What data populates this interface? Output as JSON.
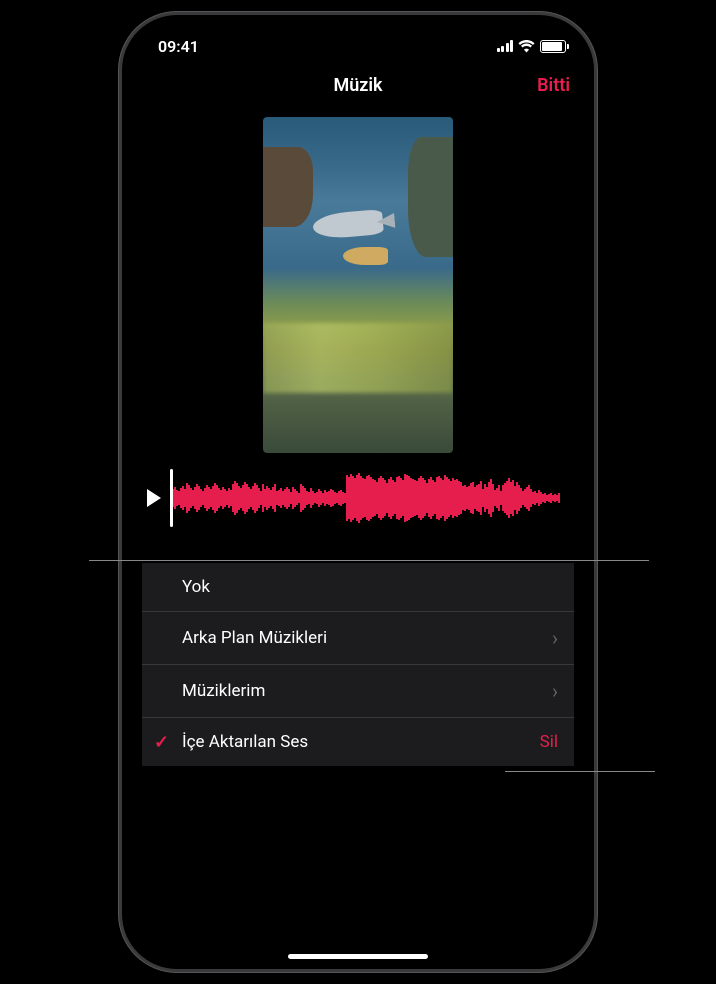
{
  "status": {
    "time": "09:41"
  },
  "nav": {
    "title": "Müzik",
    "done": "Bitti"
  },
  "options": {
    "none": "Yok",
    "soundtracks": "Arka Plan Müzikleri",
    "my_music": "Müziklerim",
    "imported": "İçe Aktarılan Ses",
    "delete": "Sil"
  },
  "waveform": {
    "heights": [
      12,
      18,
      22,
      16,
      14,
      20,
      24,
      18,
      30,
      26,
      20,
      16,
      22,
      28,
      24,
      18,
      14,
      20,
      26,
      22,
      18,
      24,
      30,
      26,
      20,
      16,
      22,
      18,
      14,
      20,
      16,
      28,
      34,
      30,
      24,
      20,
      26,
      32,
      28,
      22,
      18,
      24,
      30,
      26,
      20,
      14,
      28,
      18,
      24,
      20,
      16,
      22,
      28,
      14,
      16,
      20,
      14,
      18,
      22,
      18,
      12,
      22,
      18,
      14,
      10,
      28,
      24,
      20,
      14,
      12,
      20,
      14,
      10,
      12,
      18,
      14,
      10,
      16,
      12,
      14,
      18,
      16,
      12,
      10,
      14,
      16,
      12,
      10,
      46,
      42,
      48,
      44,
      40,
      46,
      50,
      44,
      40,
      38,
      44,
      46,
      42,
      38,
      36,
      32,
      40,
      44,
      40,
      36,
      30,
      38,
      42,
      36,
      32,
      42,
      44,
      40,
      36,
      48,
      46,
      44,
      40,
      38,
      36,
      34,
      40,
      44,
      40,
      36,
      30,
      38,
      42,
      36,
      32,
      42,
      44,
      40,
      36,
      46,
      42,
      38,
      34,
      40,
      36,
      38,
      34,
      32,
      24,
      26,
      22,
      24,
      30,
      32,
      22,
      26,
      28,
      34,
      18,
      28,
      22,
      32,
      38,
      28,
      16,
      20,
      26,
      14,
      26,
      30,
      34,
      40,
      32,
      36,
      24,
      32,
      26,
      20,
      14,
      18,
      22,
      26,
      18,
      12,
      14,
      10,
      16,
      12,
      8,
      10,
      6,
      8,
      10,
      6,
      8,
      6,
      10
    ]
  }
}
